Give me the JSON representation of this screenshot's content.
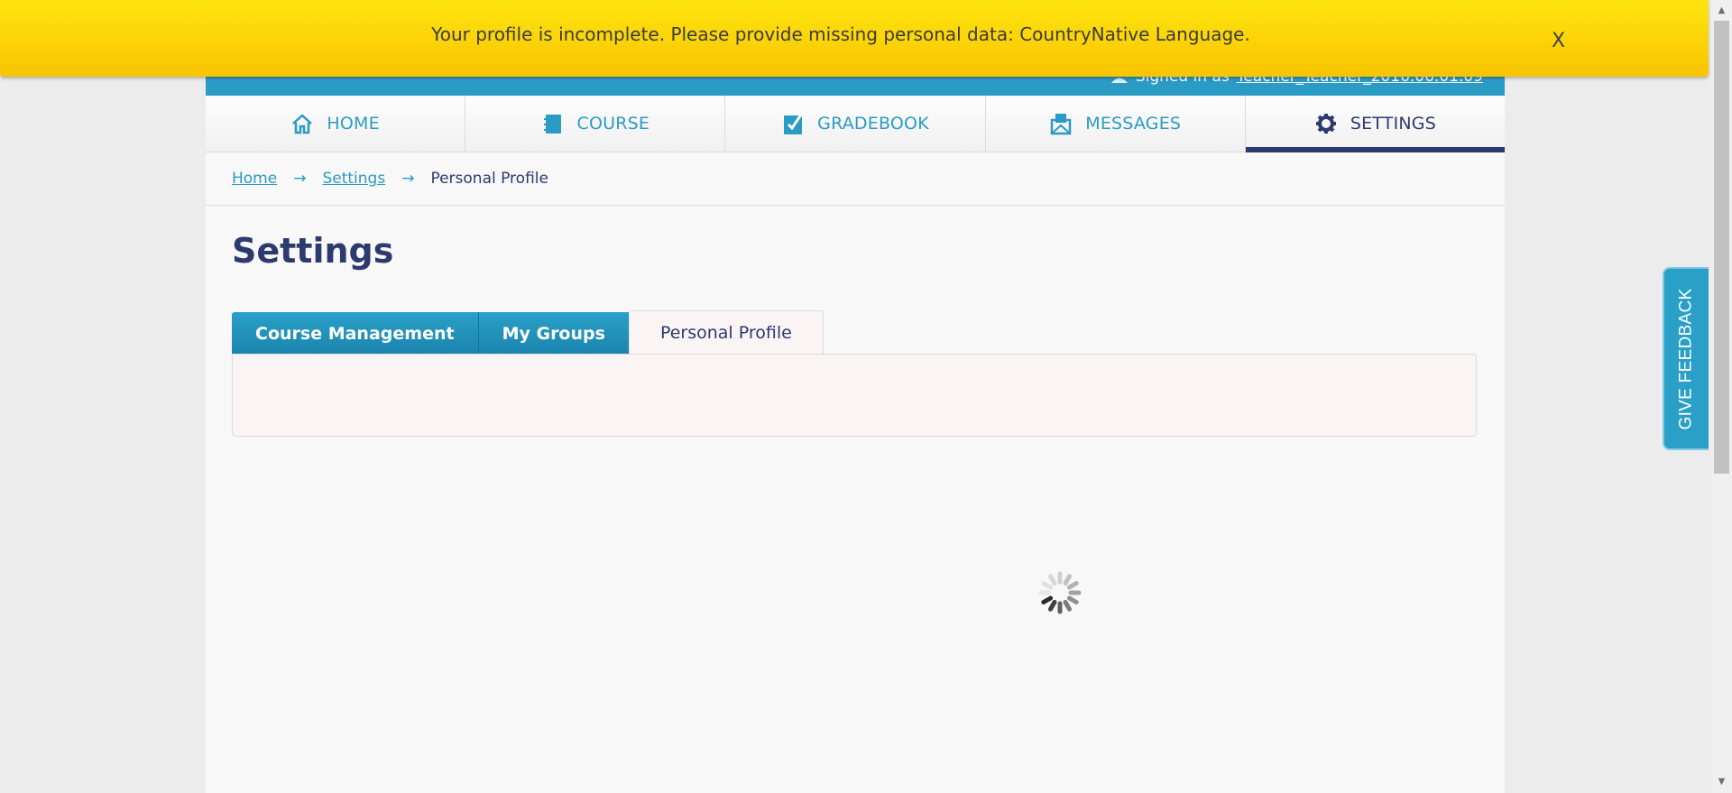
{
  "banner": {
    "message": "Your profile is incomplete. Please provide missing personal data: CountryNative Language.",
    "close_label": "X"
  },
  "header": {
    "signed_in_prefix": "Signed in as",
    "user_name": "Teacher_Teacher_2016.06.01.09"
  },
  "nav": {
    "items": [
      {
        "label": "HOME",
        "icon": "house-icon"
      },
      {
        "label": "COURSE",
        "icon": "book-icon"
      },
      {
        "label": "GRADEBOOK",
        "icon": "checkbook-icon"
      },
      {
        "label": "MESSAGES",
        "icon": "envelope-icon"
      },
      {
        "label": "SETTINGS",
        "icon": "gear-icon",
        "active": true
      }
    ]
  },
  "breadcrumb": {
    "home": "Home",
    "settings": "Settings",
    "current": "Personal Profile",
    "separator": "→"
  },
  "page": {
    "title": "Settings"
  },
  "tabs": [
    {
      "label": "Course Management"
    },
    {
      "label": "My Groups"
    },
    {
      "label": "Personal Profile",
      "active": true
    }
  ],
  "feedback": {
    "label": "GIVE FEEDBACK"
  },
  "colors": {
    "accent": "#2a9bc4",
    "navy": "#2d3a6e",
    "banner": "#fdd208"
  }
}
